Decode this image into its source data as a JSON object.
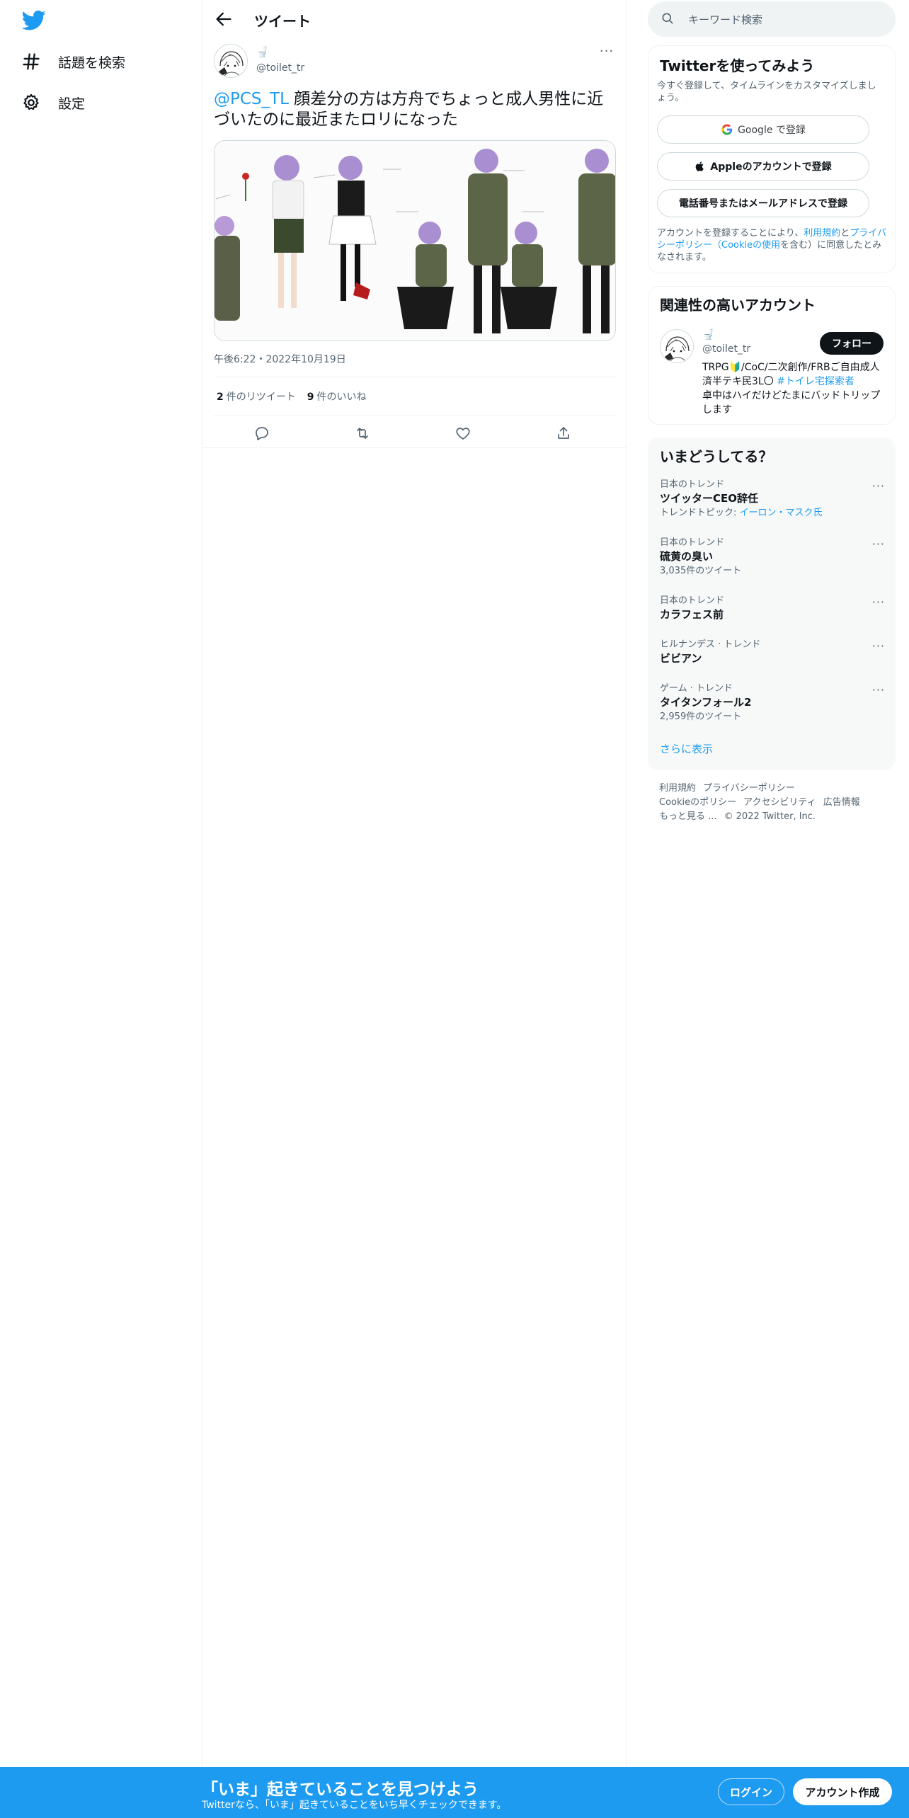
{
  "nav": {
    "logo_icon": "twitter-bird-icon",
    "items": [
      {
        "icon": "hashtag-icon",
        "label": "話題を検索"
      },
      {
        "icon": "gear-icon",
        "label": "設定"
      }
    ]
  },
  "header": {
    "title": "ツイート"
  },
  "tweet": {
    "name_emoji": "🚽",
    "handle": "@toilet_tr",
    "mention": "@PCS_TL",
    "body": " 顔差分の方は方舟でちょっと成人男性に近づいたのに最近またロリになった",
    "timestamp": "午後6:22・2022年10月19日",
    "retweet_count": "2",
    "retweet_label": "件のリツイート",
    "like_count": "9",
    "like_label": "件のいいね"
  },
  "search": {
    "placeholder": "キーワード検索"
  },
  "signup": {
    "title": "Twitterを使ってみよう",
    "subtitle": "今すぐ登録して、タイムラインをカスタマイズしましょう。",
    "google": "Google で登録",
    "apple": "Appleのアカウントで登録",
    "phone": "電話番号またはメールアドレスで登録",
    "legal_prefix": "アカウントを登録することにより、",
    "legal_terms": "利用規約",
    "legal_and": "と",
    "legal_privacy": "プライバシーポリシー",
    "legal_paren_open": "（",
    "legal_cookie": "Cookieの使用",
    "legal_suffix": "を含む）に同意したとみなされます。"
  },
  "recommend": {
    "title": "関連性の高いアカウント",
    "name_emoji": "🚽",
    "handle": "@toilet_tr",
    "follow": "フォロー",
    "bio_text": "TRPG🔰/CoC/二次創作/FRBご自由成人済半テキ民3L〇 ",
    "bio_tag": "#トイレ宅探索者",
    "bio_tail": "卓中はハイだけどたまにバッドトリップします"
  },
  "trends": {
    "title": "いまどうしてる？",
    "items": [
      {
        "meta": "日本のトレンド",
        "name": "ツイッターCEO辞任",
        "sub_prefix": "トレンドトピック: ",
        "sub_link": "イーロン・マスク氏"
      },
      {
        "meta": "日本のトレンド",
        "name": "硫黄の臭い",
        "sub": "3,035件のツイート"
      },
      {
        "meta": "日本のトレンド",
        "name": "カラフェス前"
      },
      {
        "meta": "ヒルナンデス · トレンド",
        "name": "ビビアン"
      },
      {
        "meta": "ゲーム · トレンド",
        "name": "タイタンフォール2",
        "sub": "2,959件のツイート"
      }
    ],
    "more_glyph": "···",
    "show_more": "さらに表示"
  },
  "footer": {
    "terms": "利用規約",
    "privacy": "プライバシーポリシー",
    "cookie": "Cookieのポリシー",
    "accessibility": "アクセシビリティ",
    "ads": "広告情報",
    "more": "もっと見る ...",
    "copyright": "© 2022 Twitter, Inc."
  },
  "bottom_bar": {
    "title": "「いま」起きていることを見つけよう",
    "subtitle": "Twitterなら、「いま」起きていることをいち早くチェックできます。",
    "login": "ログイン",
    "signup": "アカウント作成"
  },
  "colors": {
    "accent": "#1d9bf0",
    "text": "#0f1419",
    "muted": "#536471",
    "border": "#eff3f4"
  }
}
